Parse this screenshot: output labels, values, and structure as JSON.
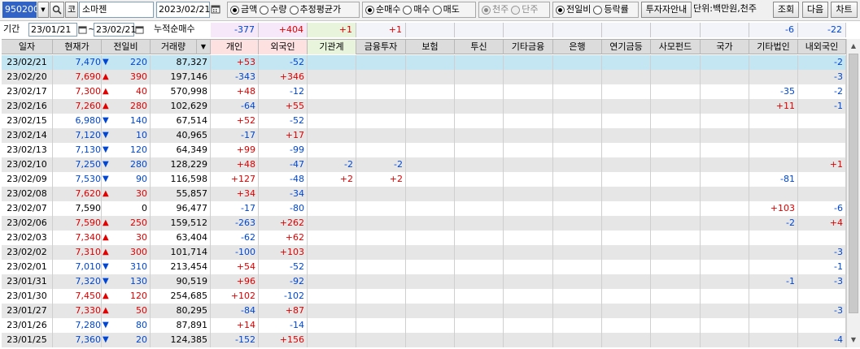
{
  "toolbar": {
    "code": "950200",
    "type_tag": "코",
    "name": "소마젠",
    "date": "2023/02/21",
    "metric_options": [
      "금액",
      "수량",
      "추정평균가"
    ],
    "metric_selected": 0,
    "buy_options": [
      "순매수",
      "매수",
      "매도"
    ],
    "buy_selected": 0,
    "share_options": [
      "천주",
      "단주"
    ],
    "share_selected": 0,
    "compare_options": [
      "전일비",
      "등락률"
    ],
    "compare_selected": 0,
    "investor_button": "투자자안내",
    "unit_label": "단위:백만원,천주",
    "query_button": "조회",
    "next_button": "다음",
    "chart_button": "차트"
  },
  "period": {
    "label": "기간",
    "start": "23/01/21",
    "separator": "~",
    "end": "23/02/21",
    "cumulative_label": "누적순매수",
    "sums": {
      "ind": "-377",
      "for": "+404",
      "inst": "+1",
      "fin": "+1",
      "etc_corp": "-6",
      "dom_for": "-22"
    }
  },
  "columns": [
    "일자",
    "현재가",
    "전일비",
    "거래량",
    "개인",
    "외국인",
    "기관계",
    "금융투자",
    "보험",
    "투신",
    "기타금융",
    "은행",
    "연기금등",
    "사모펀드",
    "국가",
    "기타법인",
    "내외국인"
  ],
  "rows": [
    {
      "date": "23/02/21",
      "price": "7,470",
      "dir": "down",
      "chg": "220",
      "vol": "87,327",
      "ind": "+53",
      "for": "-52",
      "inst": "",
      "fin": "",
      "etc_corp": "",
      "dom_for": "-2"
    },
    {
      "date": "23/02/20",
      "price": "7,690",
      "dir": "up",
      "chg": "390",
      "vol": "197,146",
      "ind": "-343",
      "for": "+346",
      "inst": "",
      "fin": "",
      "etc_corp": "",
      "dom_for": "-3"
    },
    {
      "date": "23/02/17",
      "price": "7,300",
      "dir": "up",
      "chg": "40",
      "vol": "570,998",
      "ind": "+48",
      "for": "-12",
      "inst": "",
      "fin": "",
      "etc_corp": "-35",
      "dom_for": "-2"
    },
    {
      "date": "23/02/16",
      "price": "7,260",
      "dir": "up",
      "chg": "280",
      "vol": "102,629",
      "ind": "-64",
      "for": "+55",
      "inst": "",
      "fin": "",
      "etc_corp": "+11",
      "dom_for": "-1"
    },
    {
      "date": "23/02/15",
      "price": "6,980",
      "dir": "down",
      "chg": "140",
      "vol": "67,514",
      "ind": "+52",
      "for": "-52",
      "inst": "",
      "fin": "",
      "etc_corp": "",
      "dom_for": ""
    },
    {
      "date": "23/02/14",
      "price": "7,120",
      "dir": "down",
      "chg": "10",
      "vol": "40,965",
      "ind": "-17",
      "for": "+17",
      "inst": "",
      "fin": "",
      "etc_corp": "",
      "dom_for": ""
    },
    {
      "date": "23/02/13",
      "price": "7,130",
      "dir": "down",
      "chg": "120",
      "vol": "64,349",
      "ind": "+99",
      "for": "-99",
      "inst": "",
      "fin": "",
      "etc_corp": "",
      "dom_for": ""
    },
    {
      "date": "23/02/10",
      "price": "7,250",
      "dir": "down",
      "chg": "280",
      "vol": "128,229",
      "ind": "+48",
      "for": "-47",
      "inst": "-2",
      "fin": "-2",
      "etc_corp": "",
      "dom_for": "+1"
    },
    {
      "date": "23/02/09",
      "price": "7,530",
      "dir": "down",
      "chg": "90",
      "vol": "116,598",
      "ind": "+127",
      "for": "-48",
      "inst": "+2",
      "fin": "+2",
      "etc_corp": "-81",
      "dom_for": ""
    },
    {
      "date": "23/02/08",
      "price": "7,620",
      "dir": "up",
      "chg": "30",
      "vol": "55,857",
      "ind": "+34",
      "for": "-34",
      "inst": "",
      "fin": "",
      "etc_corp": "",
      "dom_for": ""
    },
    {
      "date": "23/02/07",
      "price": "7,590",
      "dir": "none",
      "chg": "0",
      "vol": "96,477",
      "ind": "-17",
      "for": "-80",
      "inst": "",
      "fin": "",
      "etc_corp": "+103",
      "dom_for": "-6"
    },
    {
      "date": "23/02/06",
      "price": "7,590",
      "dir": "up",
      "chg": "250",
      "vol": "159,512",
      "ind": "-263",
      "for": "+262",
      "inst": "",
      "fin": "",
      "etc_corp": "-2",
      "dom_for": "+4"
    },
    {
      "date": "23/02/03",
      "price": "7,340",
      "dir": "up",
      "chg": "30",
      "vol": "63,404",
      "ind": "-62",
      "for": "+62",
      "inst": "",
      "fin": "",
      "etc_corp": "",
      "dom_for": ""
    },
    {
      "date": "23/02/02",
      "price": "7,310",
      "dir": "up",
      "chg": "300",
      "vol": "101,714",
      "ind": "-100",
      "for": "+103",
      "inst": "",
      "fin": "",
      "etc_corp": "",
      "dom_for": "-3"
    },
    {
      "date": "23/02/01",
      "price": "7,010",
      "dir": "down",
      "chg": "310",
      "vol": "213,454",
      "ind": "+54",
      "for": "-52",
      "inst": "",
      "fin": "",
      "etc_corp": "",
      "dom_for": "-1"
    },
    {
      "date": "23/01/31",
      "price": "7,320",
      "dir": "down",
      "chg": "130",
      "vol": "90,519",
      "ind": "+96",
      "for": "-92",
      "inst": "",
      "fin": "",
      "etc_corp": "-1",
      "dom_for": "-3"
    },
    {
      "date": "23/01/30",
      "price": "7,450",
      "dir": "up",
      "chg": "120",
      "vol": "254,685",
      "ind": "+102",
      "for": "-102",
      "inst": "",
      "fin": "",
      "etc_corp": "",
      "dom_for": ""
    },
    {
      "date": "23/01/27",
      "price": "7,330",
      "dir": "up",
      "chg": "50",
      "vol": "80,295",
      "ind": "-84",
      "for": "+87",
      "inst": "",
      "fin": "",
      "etc_corp": "",
      "dom_for": "-3"
    },
    {
      "date": "23/01/26",
      "price": "7,280",
      "dir": "down",
      "chg": "80",
      "vol": "87,891",
      "ind": "+14",
      "for": "-14",
      "inst": "",
      "fin": "",
      "etc_corp": "",
      "dom_for": ""
    },
    {
      "date": "23/01/25",
      "price": "7,360",
      "dir": "down",
      "chg": "20",
      "vol": "124,385",
      "ind": "-152",
      "for": "+156",
      "inst": "",
      "fin": "",
      "etc_corp": "",
      "dom_for": "-4"
    }
  ],
  "colors": {
    "up": "#e00000",
    "down": "#0046d5",
    "selected_row": "#c4e6f2",
    "alt_row": "#e6e6e6"
  },
  "icons": {
    "up": "▲",
    "down": "▼",
    "calendar": "calendar-icon",
    "search": "search-icon"
  }
}
